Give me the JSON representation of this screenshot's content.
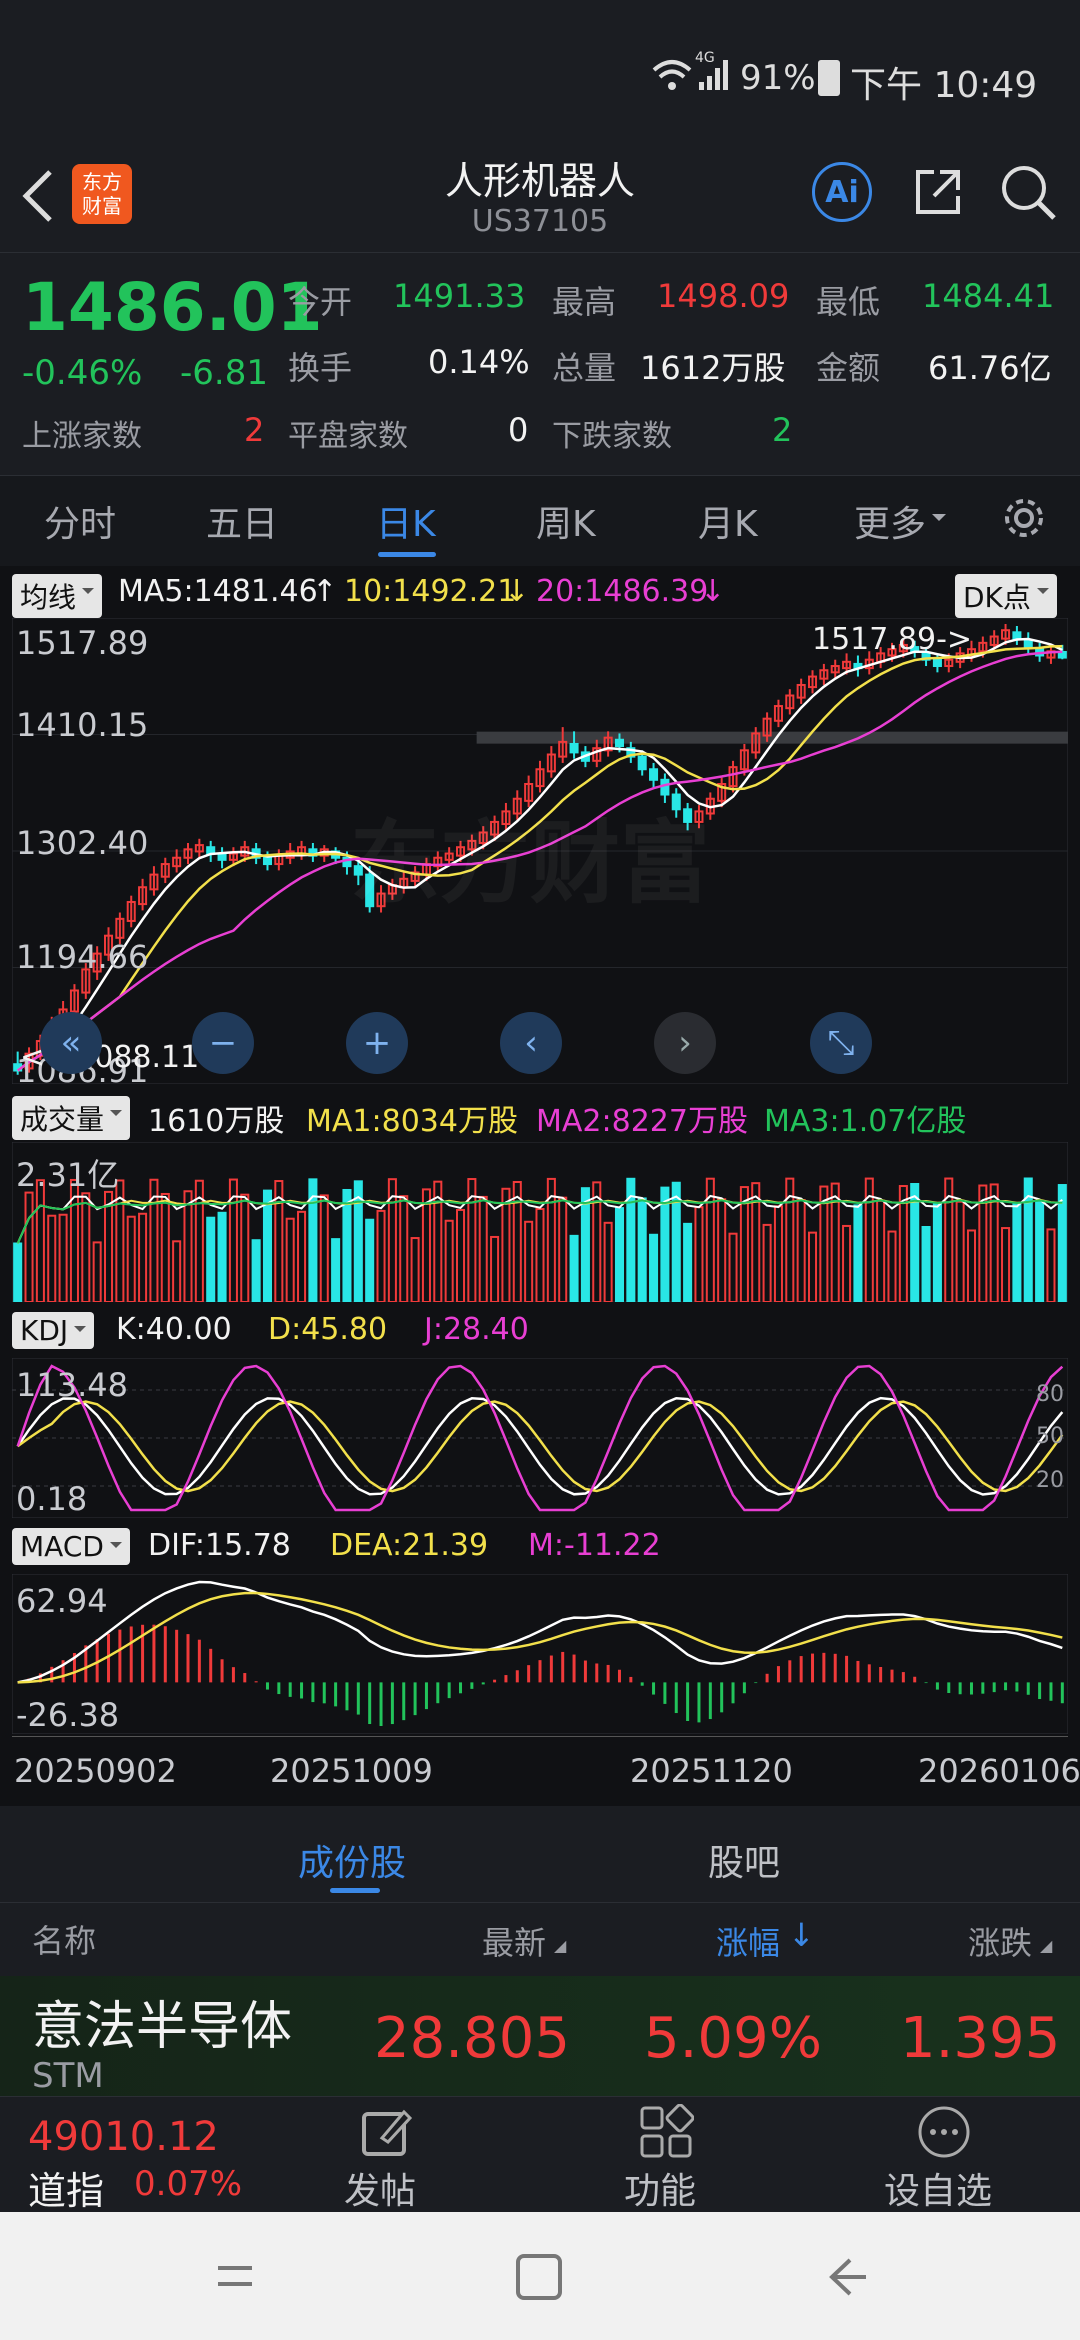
{
  "status_bar": {
    "signal": "4G",
    "battery": "91%",
    "time": "下午 10:49"
  },
  "header": {
    "title": "人形机器人",
    "subtitle": "US37105",
    "logo_text": "东方\n财富",
    "ai_label": "Ai"
  },
  "quote": {
    "price": "1486.01",
    "change_pct": "-0.46%",
    "change": "-6.81",
    "open_label": "今开",
    "open": "1491.33",
    "high_label": "最高",
    "high": "1498.09",
    "low_label": "最低",
    "low": "1484.41",
    "turnover_label": "换手",
    "turnover": "0.14%",
    "volume_label": "总量",
    "volume": "1612万股",
    "amount_label": "金额",
    "amount": "61.76亿",
    "up_label": "上涨家数",
    "up": "2",
    "flat_label": "平盘家数",
    "flat": "0",
    "down_label": "下跌家数",
    "down": "2"
  },
  "tabs": [
    {
      "label": "分时"
    },
    {
      "label": "五日"
    },
    {
      "label": "日K"
    },
    {
      "label": "周K"
    },
    {
      "label": "月K"
    },
    {
      "label": "更多"
    }
  ],
  "kline": {
    "ma_selector": "均线",
    "ma5": "MA5:1481.46",
    "ma10": "10:1492.21",
    "ma20": "20:1486.39",
    "dk_label": "DK点",
    "y_labels": [
      "1517.89",
      "1410.15",
      "1302.40",
      "1194.66",
      "1086.91"
    ],
    "max_marker": "1517.89",
    "min_marker": "1088.11",
    "watermark": "东方财富"
  },
  "volume": {
    "selector": "成交量",
    "value": "1610万股",
    "ma1": "MA1:8034万股",
    "ma2": "MA2:8227万股",
    "ma3": "MA3:1.07亿股",
    "y_top": "2.31亿"
  },
  "kdj": {
    "selector": "KDJ",
    "k": "K:40.00",
    "d": "D:45.80",
    "j": "J:28.40",
    "y_top": "113.48",
    "y_bottom": "0.18",
    "levels": [
      "80",
      "50",
      "20"
    ]
  },
  "macd": {
    "selector": "MACD",
    "dif": "DIF:15.78",
    "dea": "DEA:21.39",
    "m": "M:-11.22",
    "y_top": "62.94",
    "y_bottom": "-26.38"
  },
  "dates": [
    "20250902",
    "20251009",
    "20251120",
    "20260106"
  ],
  "section_tabs": [
    {
      "label": "成份股"
    },
    {
      "label": "股吧"
    }
  ],
  "list_headers": {
    "name": "名称",
    "latest": "最新",
    "change_pct": "涨幅",
    "change": "涨跌"
  },
  "constituents": [
    {
      "name": "意法半导体",
      "code": "STM",
      "latest": "28.805",
      "change_pct": "5.09%",
      "change": "1.395"
    }
  ],
  "bottom_bar": {
    "index_value": "49010.12",
    "index_name": "道指",
    "index_change": "0.07%",
    "post": "发帖",
    "func": "功能",
    "watch": "设自选"
  },
  "colors": {
    "up": "#f03a3a",
    "down": "#22c35b",
    "accent": "#3b88e6",
    "bg": "#1b1d22"
  },
  "chart_data": {
    "type": "candlestick",
    "x_ticks": [
      "20250902",
      "20251009",
      "20251120",
      "20260106"
    ],
    "ylim": [
      1086.91,
      1517.89
    ],
    "candles": [
      [
        1100,
        1094,
        1112,
        1090
      ],
      [
        1096,
        1110,
        1116,
        1092
      ],
      [
        1108,
        1122,
        1128,
        1104
      ],
      [
        1120,
        1138,
        1145,
        1116
      ],
      [
        1136,
        1152,
        1160,
        1130
      ],
      [
        1150,
        1170,
        1176,
        1146
      ],
      [
        1168,
        1190,
        1196,
        1162
      ],
      [
        1188,
        1205,
        1212,
        1180
      ],
      [
        1204,
        1222,
        1230,
        1198
      ],
      [
        1220,
        1238,
        1244,
        1214
      ],
      [
        1236,
        1254,
        1260,
        1230
      ],
      [
        1252,
        1268,
        1276,
        1246
      ],
      [
        1266,
        1280,
        1288,
        1260
      ],
      [
        1278,
        1290,
        1296,
        1272
      ],
      [
        1288,
        1296,
        1304,
        1282
      ],
      [
        1296,
        1304,
        1310,
        1290
      ],
      [
        1302,
        1308,
        1314,
        1296
      ],
      [
        1306,
        1300,
        1312,
        1292
      ],
      [
        1300,
        1294,
        1306,
        1286
      ],
      [
        1294,
        1300,
        1306,
        1288
      ],
      [
        1298,
        1306,
        1312,
        1292
      ],
      [
        1304,
        1296,
        1310,
        1290
      ],
      [
        1296,
        1290,
        1302,
        1284
      ],
      [
        1290,
        1298,
        1304,
        1284
      ],
      [
        1296,
        1302,
        1310,
        1290
      ],
      [
        1300,
        1306,
        1312,
        1294
      ],
      [
        1304,
        1298,
        1310,
        1292
      ],
      [
        1298,
        1304,
        1308,
        1292
      ],
      [
        1302,
        1296,
        1306,
        1290
      ],
      [
        1296,
        1288,
        1302,
        1280
      ],
      [
        1288,
        1280,
        1294,
        1270
      ],
      [
        1280,
        1250,
        1288,
        1244
      ],
      [
        1250,
        1262,
        1270,
        1244
      ],
      [
        1262,
        1270,
        1276,
        1256
      ],
      [
        1268,
        1276,
        1282,
        1262
      ],
      [
        1274,
        1282,
        1288,
        1268
      ],
      [
        1280,
        1290,
        1296,
        1274
      ],
      [
        1288,
        1296,
        1302,
        1282
      ],
      [
        1294,
        1300,
        1306,
        1288
      ],
      [
        1298,
        1306,
        1312,
        1292
      ],
      [
        1304,
        1312,
        1318,
        1298
      ],
      [
        1310,
        1320,
        1326,
        1304
      ],
      [
        1318,
        1330,
        1336,
        1312
      ],
      [
        1328,
        1340,
        1348,
        1322
      ],
      [
        1338,
        1352,
        1360,
        1332
      ],
      [
        1350,
        1366,
        1374,
        1344
      ],
      [
        1364,
        1380,
        1388,
        1358
      ],
      [
        1378,
        1394,
        1402,
        1372
      ],
      [
        1392,
        1406,
        1420,
        1386
      ],
      [
        1404,
        1396,
        1416,
        1390
      ],
      [
        1396,
        1388,
        1402,
        1382
      ],
      [
        1388,
        1400,
        1408,
        1382
      ],
      [
        1398,
        1410,
        1416,
        1392
      ],
      [
        1408,
        1402,
        1414,
        1396
      ],
      [
        1400,
        1392,
        1406,
        1386
      ],
      [
        1392,
        1380,
        1398,
        1374
      ],
      [
        1380,
        1370,
        1386,
        1362
      ],
      [
        1370,
        1356,
        1376,
        1348
      ],
      [
        1356,
        1342,
        1362,
        1334
      ],
      [
        1342,
        1330,
        1348,
        1322
      ],
      [
        1330,
        1340,
        1346,
        1324
      ],
      [
        1338,
        1352,
        1358,
        1332
      ],
      [
        1350,
        1366,
        1372,
        1344
      ],
      [
        1364,
        1382,
        1388,
        1358
      ],
      [
        1380,
        1398,
        1404,
        1374
      ],
      [
        1396,
        1414,
        1420,
        1390
      ],
      [
        1412,
        1428,
        1434,
        1406
      ],
      [
        1426,
        1440,
        1446,
        1420
      ],
      [
        1438,
        1450,
        1456,
        1432
      ],
      [
        1448,
        1460,
        1466,
        1442
      ],
      [
        1458,
        1468,
        1474,
        1452
      ],
      [
        1466,
        1474,
        1480,
        1460
      ],
      [
        1472,
        1478,
        1484,
        1466
      ],
      [
        1476,
        1482,
        1490,
        1470
      ],
      [
        1480,
        1476,
        1488,
        1468
      ],
      [
        1476,
        1484,
        1492,
        1470
      ],
      [
        1482,
        1490,
        1496,
        1476
      ],
      [
        1488,
        1494,
        1500,
        1482
      ],
      [
        1492,
        1498,
        1504,
        1486
      ],
      [
        1496,
        1492,
        1502,
        1486
      ],
      [
        1490,
        1484,
        1496,
        1478
      ],
      [
        1484,
        1478,
        1490,
        1472
      ],
      [
        1478,
        1484,
        1490,
        1472
      ],
      [
        1482,
        1490,
        1496,
        1476
      ],
      [
        1488,
        1494,
        1502,
        1482
      ],
      [
        1492,
        1500,
        1506,
        1486
      ],
      [
        1498,
        1506,
        1512,
        1492
      ],
      [
        1504,
        1512,
        1517.89,
        1498
      ],
      [
        1510,
        1504,
        1516,
        1498
      ],
      [
        1502,
        1496,
        1510,
        1490
      ],
      [
        1494,
        1488,
        1500,
        1482
      ],
      [
        1486,
        1492,
        1498,
        1480
      ],
      [
        1491.33,
        1486.01,
        1498.09,
        1484.41
      ]
    ]
  }
}
